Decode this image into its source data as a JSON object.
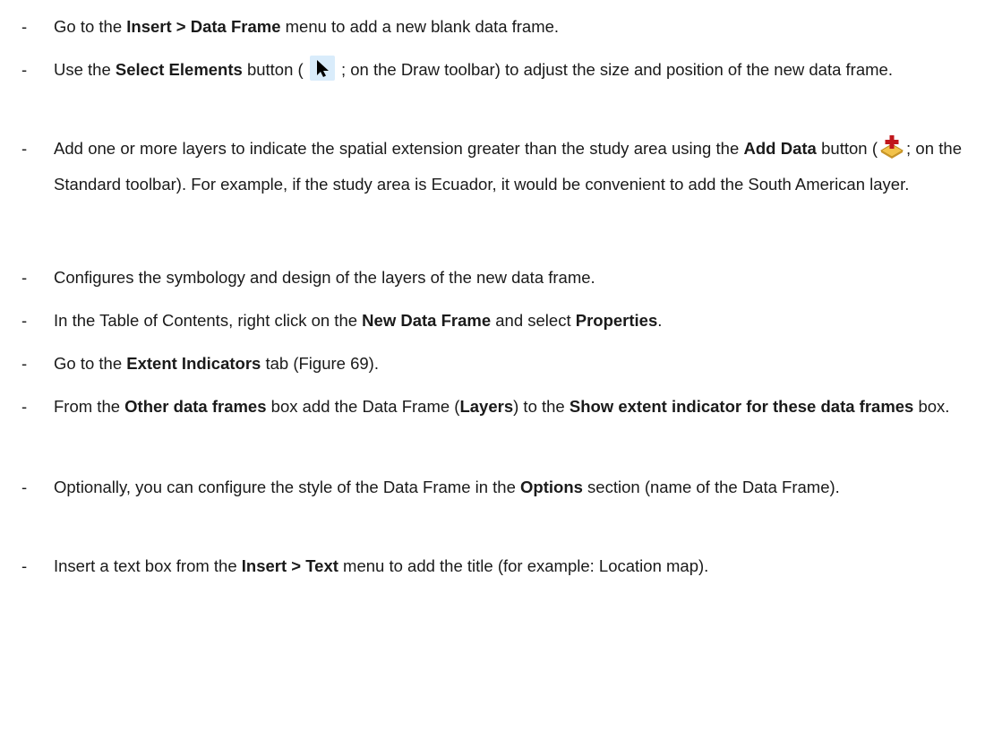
{
  "steps": [
    {
      "parts": [
        {
          "t": "Go to the "
        },
        {
          "b": "Insert > Data Frame"
        },
        {
          "t": " menu to add a new blank data frame."
        }
      ]
    },
    {
      "parts": [
        {
          "t": "Use the "
        },
        {
          "b": "Select Elements"
        },
        {
          "t": " button ( "
        },
        {
          "icon": "select-elements-arrow-icon"
        },
        {
          "t": " ; on the Draw toolbar) to adjust the size and position of the new data frame."
        }
      ]
    },
    {
      "parts": [
        {
          "t": "Add one or more layers to indicate the spatial extension greater than the study area using the "
        },
        {
          "b": "Add Data"
        },
        {
          "t": " button ("
        },
        {
          "icon": "add-data-plus-icon"
        },
        {
          "t": "; on the Standard toolbar). For example, if the study area is Ecuador, it would be convenient to add the South American layer."
        }
      ]
    },
    {
      "parts": [
        {
          "t": "Configures the symbology and design of the layers of the new data frame."
        }
      ]
    },
    {
      "parts": [
        {
          "t": "In the Table of Contents, right click on the "
        },
        {
          "b": "New Data Frame"
        },
        {
          "t": " and select "
        },
        {
          "b": "Properties"
        },
        {
          "t": "."
        }
      ]
    },
    {
      "parts": [
        {
          "t": "Go to the "
        },
        {
          "b": "Extent Indicators"
        },
        {
          "t": " tab (Figure 69)."
        }
      ]
    },
    {
      "parts": [
        {
          "t": "From the "
        },
        {
          "b": "Other data frames"
        },
        {
          "t": " box add the Data Frame ("
        },
        {
          "b": "Layers"
        },
        {
          "t": ") to the "
        },
        {
          "b": "Show extent indicator for these data frames"
        },
        {
          "t": " box."
        }
      ]
    },
    {
      "parts": [
        {
          "t": "Optionally, you can configure the style of the Data Frame in the "
        },
        {
          "b": "Options"
        },
        {
          "t": " section (name of the Data Frame)."
        }
      ]
    },
    {
      "parts": [
        {
          "t": "Insert a text box from the "
        },
        {
          "b": "Insert > Text"
        },
        {
          "t": " menu to add the title (for example: Location map)."
        }
      ]
    }
  ],
  "bullet": "-"
}
